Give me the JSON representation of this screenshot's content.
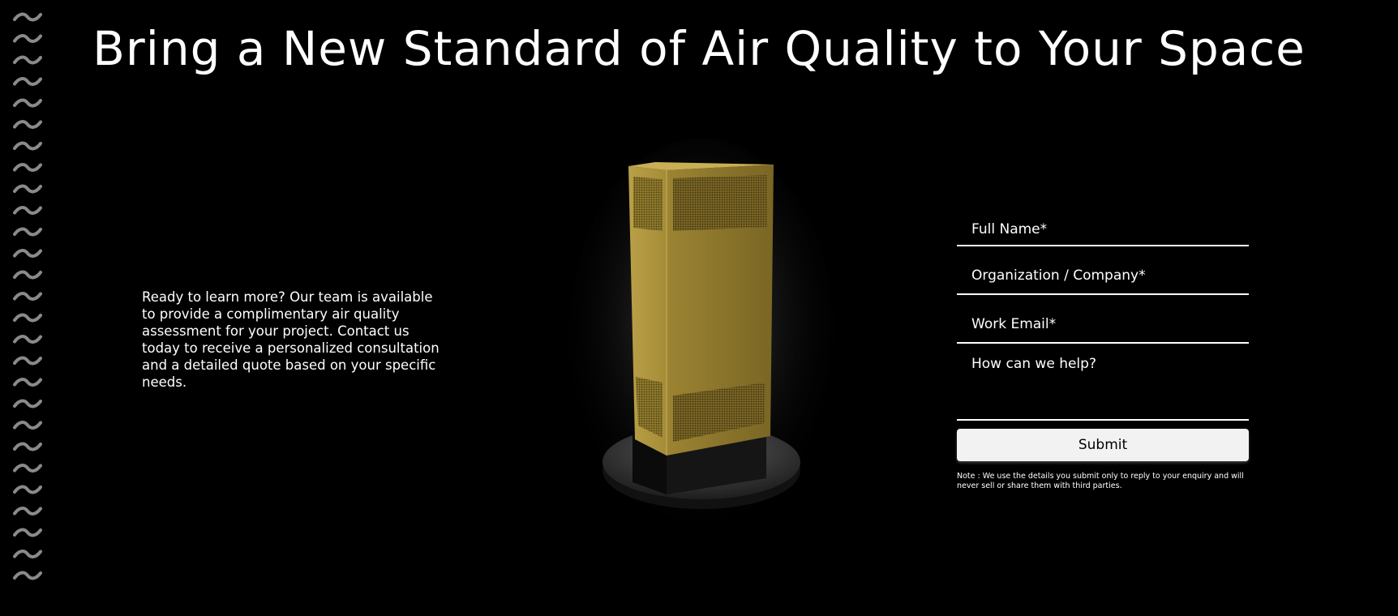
{
  "headline": "Bring a New Standard of Air Quality to Your Space",
  "intro": "Ready to learn more? Our team is available to provide a complimentary air quality assessment for your project. Contact us today to receive a personalized consultation and a detailed quote based on your specific needs.",
  "form": {
    "full_name_placeholder": "Full Name*",
    "full_name_value": "",
    "organization_placeholder": "Organization / Company*",
    "organization_value": "",
    "work_email_placeholder": "Work Email*",
    "work_email_value": "",
    "message_placeholder": "How can we help?",
    "message_value": "",
    "submit_label": "Submit",
    "note": "Note : We use the details you submit only to reply to your enquiry and will never sell or share them with third parties."
  },
  "decoration": {
    "left_pattern_icon": "wave-pattern-icon",
    "product_image": "air-purifier-tower"
  },
  "colors": {
    "background": "#000000",
    "text": "#ffffff",
    "product_gold": "#b39a3e",
    "wave_gray": "#8a8a8a",
    "button_bg": "#f2f2f2"
  }
}
